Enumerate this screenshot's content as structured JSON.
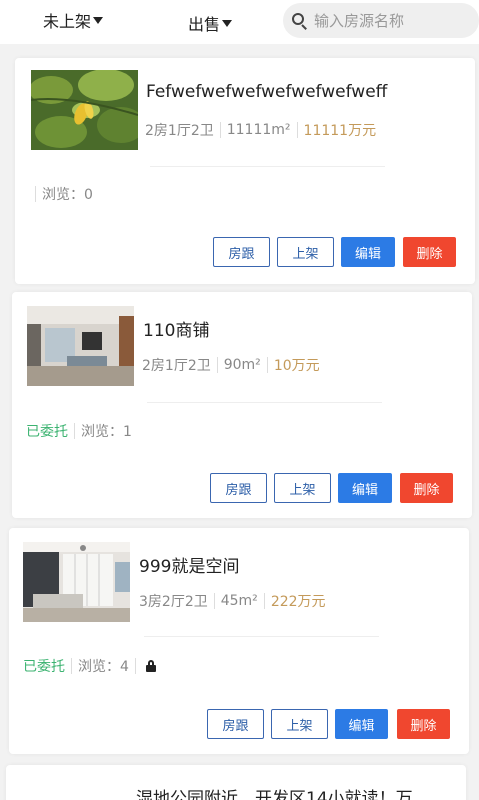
{
  "topbar": {
    "status_filter": "未上架",
    "type_filter": "出售",
    "search_placeholder": "输入房源名称"
  },
  "listings": [
    {
      "title": "Fefwefwefwefwefwefwefweff",
      "layout": "2房1厅2卫",
      "area": "11111m²",
      "price": "11111万元",
      "status": "",
      "views": "浏览：0",
      "locked": false
    },
    {
      "title": "110商铺",
      "layout": "2房1厅2卫",
      "area": "90m²",
      "price": "10万元",
      "status": "已委托",
      "views": "浏览：1",
      "locked": false
    },
    {
      "title": "999就是空间",
      "layout": "3房2厅2卫",
      "area": "45m²",
      "price": "222万元",
      "status": "已委托",
      "views": "浏览：4",
      "locked": true
    }
  ],
  "buttons": {
    "follow": "房跟",
    "publish": "上架",
    "edit": "编辑",
    "delete": "删除"
  },
  "partial_listing": {
    "title": "湿地公园附近，开发区14小就读！万"
  },
  "colors": {
    "price": "#c49a5a",
    "status": "#3cb371",
    "edit": "#2c7be5",
    "delete": "#f0472f"
  }
}
